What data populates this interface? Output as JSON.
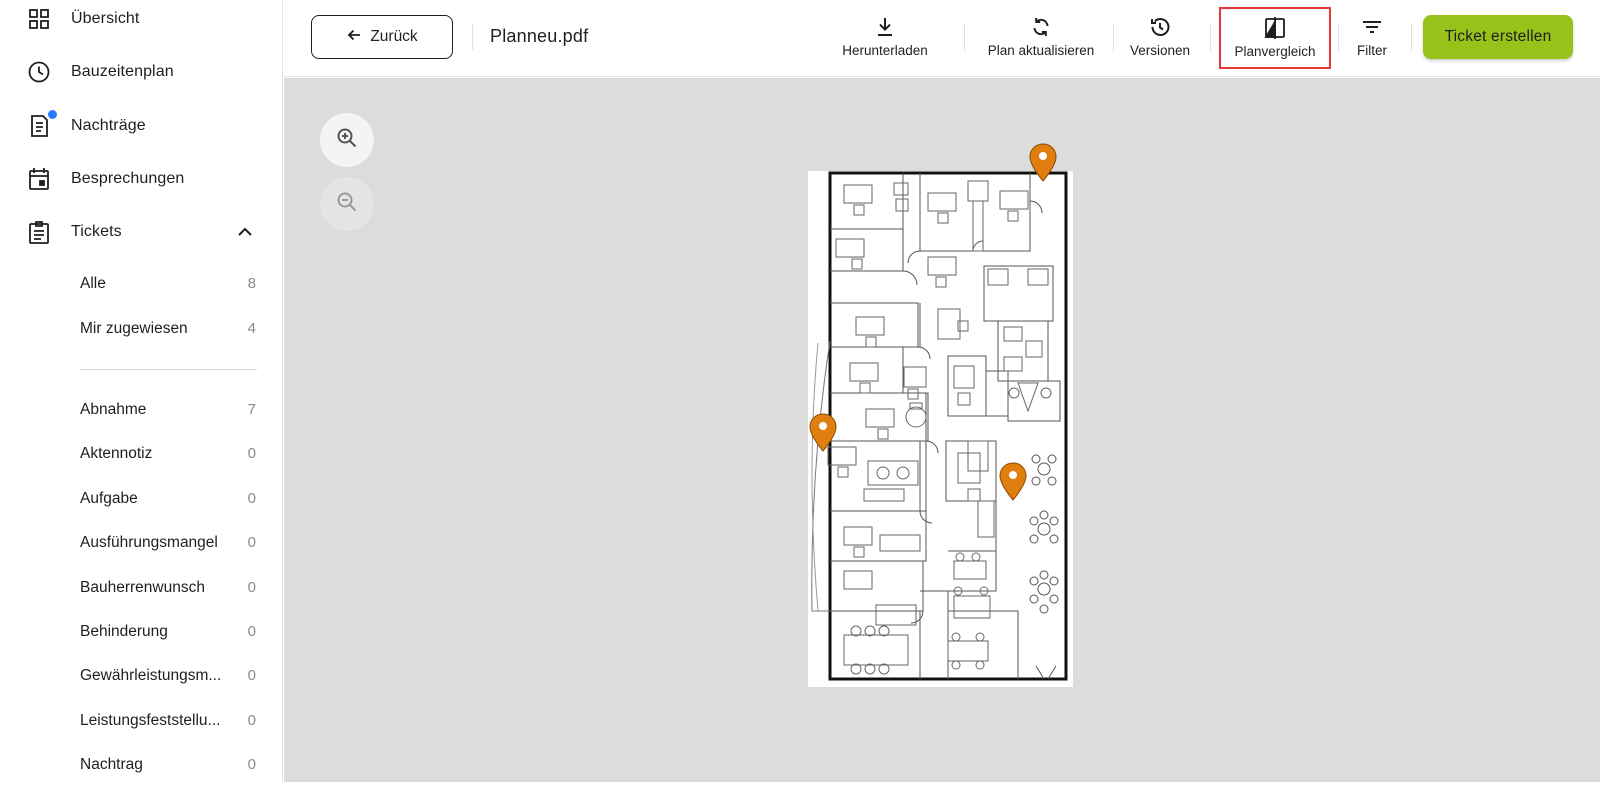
{
  "sidebar": {
    "nav": [
      {
        "label": "Übersicht",
        "icon": "dashboard-icon"
      },
      {
        "label": "Bauzeitenplan",
        "icon": "clock-icon"
      },
      {
        "label": "Nachträge",
        "icon": "document-list-icon",
        "notification": true
      },
      {
        "label": "Besprechungen",
        "icon": "calendar-icon"
      },
      {
        "label": "Tickets",
        "icon": "clipboard-icon",
        "expanded": true
      }
    ],
    "tickets_filters": [
      {
        "label": "Alle",
        "count": "8"
      },
      {
        "label": "Mir zugewiesen",
        "count": "4"
      }
    ],
    "ticket_types": [
      {
        "label": "Abnahme",
        "count": "7"
      },
      {
        "label": "Aktennotiz",
        "count": "0"
      },
      {
        "label": "Aufgabe",
        "count": "0"
      },
      {
        "label": "Ausführungsmangel",
        "count": "0"
      },
      {
        "label": "Bauherrenwunsch",
        "count": "0"
      },
      {
        "label": "Behinderung",
        "count": "0"
      },
      {
        "label": "Gewährleistungsm...",
        "count": "0"
      },
      {
        "label": "Leistungsfeststellu...",
        "count": "0"
      },
      {
        "label": "Nachtrag",
        "count": "0"
      }
    ]
  },
  "header": {
    "back_label": "Zurück",
    "file_name": "Planneu.pdf",
    "tools": [
      {
        "label": "Herunterladen",
        "icon": "download-icon"
      },
      {
        "label": "Plan aktualisieren",
        "icon": "refresh-icon"
      },
      {
        "label": "Versionen",
        "icon": "history-icon"
      },
      {
        "label": "Planvergleich",
        "icon": "compare-icon",
        "highlighted": true
      },
      {
        "label": "Filter",
        "icon": "filter-icon"
      }
    ],
    "create_ticket_label": "Ticket erstellen"
  },
  "canvas": {
    "zoom_in_icon": "zoom-in-icon",
    "zoom_out_icon": "zoom-out-icon",
    "pin_color": "#e07f0f",
    "pin_count": 3
  },
  "colors": {
    "accent_green": "#97c21a",
    "notification_blue": "#2979ff",
    "highlight_red": "#e53935"
  }
}
